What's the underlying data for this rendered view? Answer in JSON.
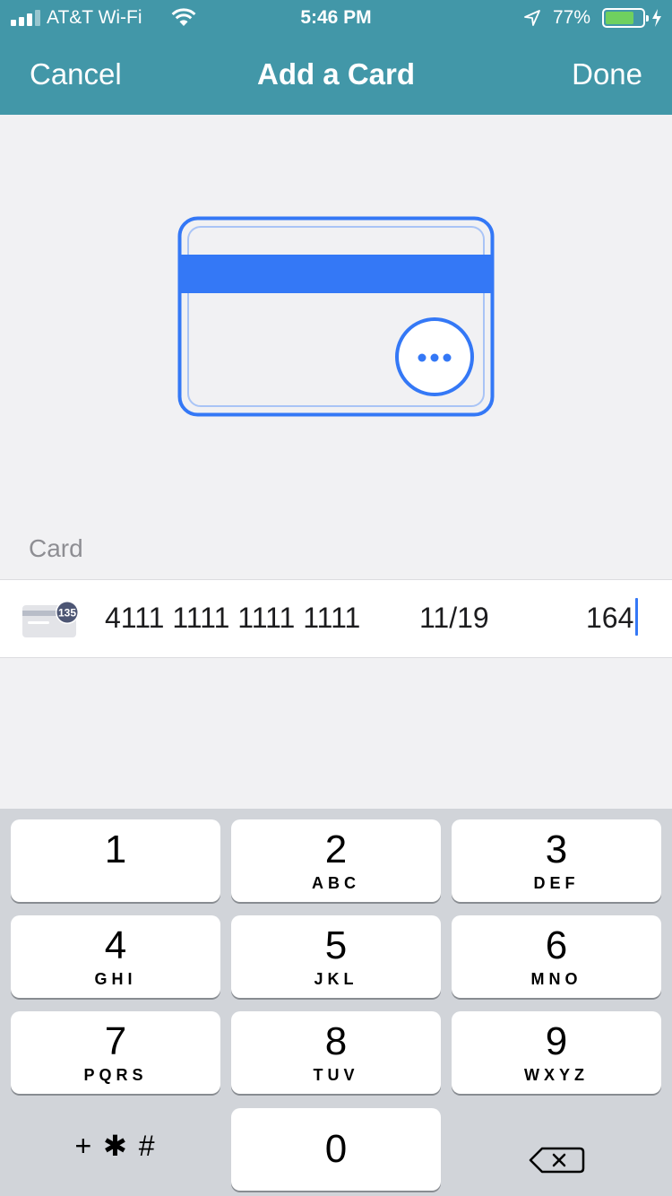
{
  "status_bar": {
    "carrier": "AT&T Wi-Fi",
    "time": "5:46 PM",
    "battery_percent": "77%",
    "battery_level": 0.77,
    "battery_color": "#6fd05f"
  },
  "nav": {
    "cancel_label": "Cancel",
    "title": "Add a Card",
    "done_label": "Done",
    "bar_color": "#4297a8"
  },
  "illustration": {
    "icon": "credit-card-back-with-cvc-icon",
    "accent_color": "#3478f6"
  },
  "section": {
    "label": "Card"
  },
  "card": {
    "icon": "card-cvc-hint-icon",
    "icon_badge": "135",
    "number": "4111 1111 1111 1111",
    "expiry": "11/19",
    "cvc": "164"
  },
  "keypad": {
    "keys": [
      {
        "digit": "1",
        "letters": ""
      },
      {
        "digit": "2",
        "letters": "ABC"
      },
      {
        "digit": "3",
        "letters": "DEF"
      },
      {
        "digit": "4",
        "letters": "GHI"
      },
      {
        "digit": "5",
        "letters": "JKL"
      },
      {
        "digit": "6",
        "letters": "MNO"
      },
      {
        "digit": "7",
        "letters": "PQRS"
      },
      {
        "digit": "8",
        "letters": "TUV"
      },
      {
        "digit": "9",
        "letters": "WXYZ"
      },
      {
        "digit": "0",
        "letters": ""
      }
    ],
    "symbols_label": "+ ✱ #",
    "delete_icon": "backspace-icon"
  }
}
